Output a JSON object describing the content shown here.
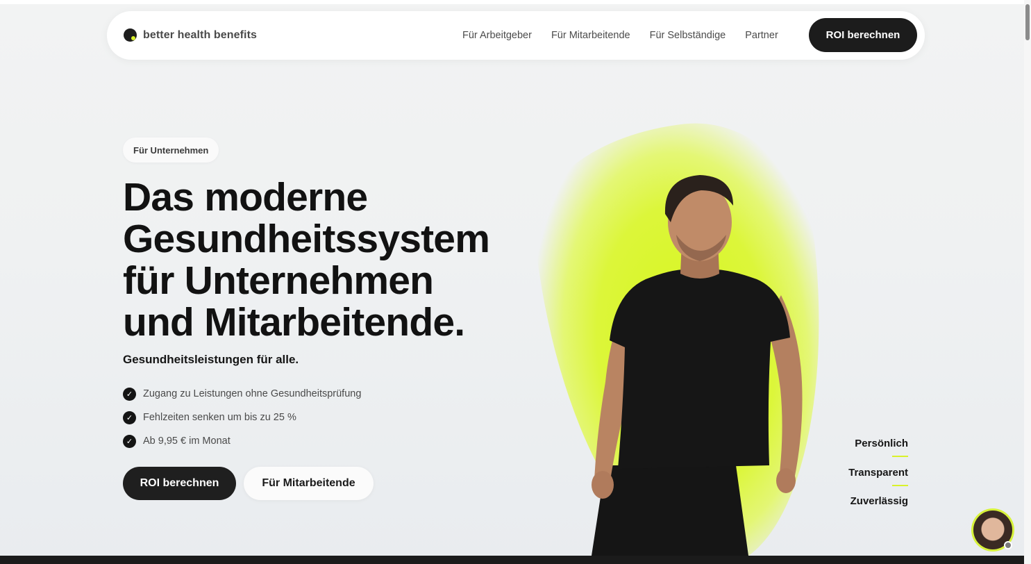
{
  "header": {
    "logo_text": "better health benefits",
    "nav": [
      "Für Arbeitgeber",
      "Für Mitarbeitende",
      "Für Selbständige",
      "Partner"
    ],
    "cta_label": "ROI berechnen"
  },
  "hero": {
    "pill": "Für Unternehmen",
    "headline_lines": [
      "Das moderne",
      "Gesundheitssystem",
      "für Unternehmen",
      "und Mitarbeitende."
    ],
    "subheadline": "Gesundheitsleistungen für alle.",
    "benefits": [
      "Zugang zu Leistungen ohne Gesundheitsprüfung",
      "Fehlzeiten senken um bis zu 25 %",
      "Ab 9,95 € im Monat"
    ],
    "primary_cta": "ROI berechnen",
    "secondary_cta": "Für Mitarbeitende"
  },
  "side_labels": [
    "Persönlich",
    "Transparent",
    "Zuverlässig"
  ],
  "colors": {
    "accent": "#d9f22a",
    "dark": "#1c1c1c",
    "background": "#eff1f2"
  },
  "icons": {
    "check": "check-icon",
    "logo": "logo-icon",
    "chat": "chat-avatar-icon"
  }
}
